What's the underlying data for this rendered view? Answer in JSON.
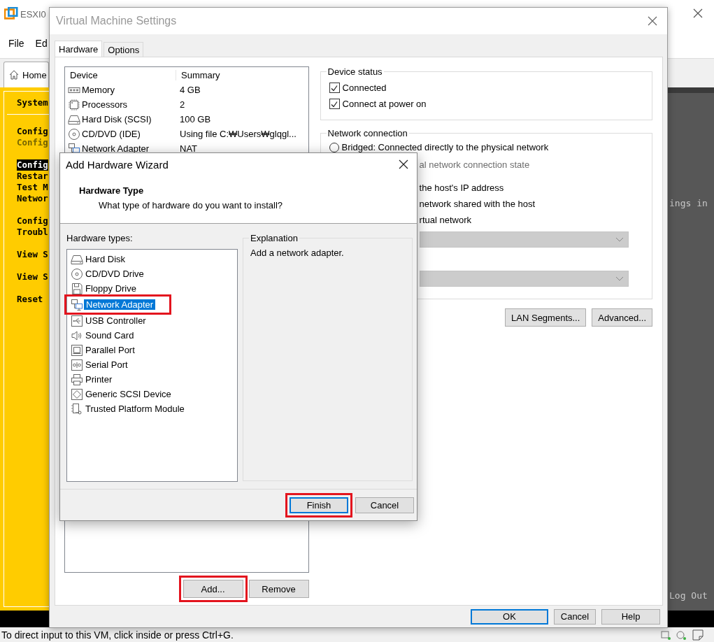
{
  "app": {
    "title": "ESXI0",
    "menu": [
      "File",
      "Ed"
    ],
    "tabs": [
      {
        "label": "Home",
        "selected": true
      }
    ],
    "console": {
      "heading": "System",
      "groups": [
        {
          "items": [
            {
              "text": "Config",
              "selected": false,
              "dimmed": false
            },
            {
              "text": "Config",
              "selected": false,
              "dimmed": true
            }
          ]
        },
        {
          "items": [
            {
              "text": "Config",
              "selected": true,
              "dimmed": false
            },
            {
              "text": "Restar",
              "selected": false,
              "dimmed": false
            },
            {
              "text": "Test M",
              "selected": false,
              "dimmed": false
            },
            {
              "text": "Networ",
              "selected": false,
              "dimmed": false
            }
          ]
        },
        {
          "items": [
            {
              "text": "Config",
              "selected": false,
              "dimmed": false
            },
            {
              "text": "Troubl",
              "selected": false,
              "dimmed": false
            }
          ]
        },
        {
          "items": [
            {
              "text": "View S",
              "selected": false,
              "dimmed": false
            }
          ]
        },
        {
          "items": [
            {
              "text": "View S",
              "selected": false,
              "dimmed": false
            }
          ]
        },
        {
          "items": [
            {
              "text": "Reset",
              "selected": false,
              "dimmed": false
            }
          ]
        }
      ]
    },
    "side_texts": [
      "ings in",
      "Log Out"
    ],
    "status_bar": "To direct input to this VM, click inside or press Ctrl+G."
  },
  "vm_settings": {
    "title": "Virtual Machine Settings",
    "tabs": [
      {
        "label": "Hardware",
        "selected": true
      },
      {
        "label": "Options",
        "selected": false
      }
    ],
    "devices": {
      "columns": [
        "Device",
        "Summary"
      ],
      "rows": [
        {
          "kind": "memory",
          "name": "Memory",
          "summary": "4 GB"
        },
        {
          "kind": "cpu",
          "name": "Processors",
          "summary": "2"
        },
        {
          "kind": "disk",
          "name": "Hard Disk (SCSI)",
          "summary": "100 GB"
        },
        {
          "kind": "cd",
          "name": "CD/DVD (IDE)",
          "summary": "Using file C:₩Users₩glqgl..."
        },
        {
          "kind": "network",
          "name": "Network Adapter",
          "summary": "NAT"
        }
      ]
    },
    "device_buttons": [
      {
        "label": "Add...",
        "highlighted": true
      },
      {
        "label": "Remove",
        "highlighted": false
      }
    ],
    "device_status": {
      "label": "Device status",
      "options": [
        {
          "label": "Connected",
          "checked": true
        },
        {
          "label": "Connect at power on",
          "checked": true
        }
      ]
    },
    "network_connection": {
      "label": "Network connection",
      "rows": [
        {
          "kind": "radio",
          "label": "Bridged: Connected directly to the physical network",
          "selected": false
        },
        {
          "kind": "text",
          "label": "al network connection state",
          "disabled": true
        },
        {
          "kind": "text",
          "label": "the host's IP address",
          "disabled": false
        },
        {
          "kind": "text",
          "label": "network shared with the host",
          "disabled": false
        },
        {
          "kind": "text",
          "label": "rtual network",
          "disabled": false
        },
        {
          "kind": "dropdown",
          "disabled": true
        },
        {
          "kind": "dropdown",
          "disabled": true
        }
      ]
    },
    "network_buttons": [
      "LAN Segments...",
      "Advanced..."
    ],
    "footer_buttons": [
      {
        "label": "OK",
        "default": true
      },
      {
        "label": "Cancel",
        "default": false
      },
      {
        "label": "Help",
        "default": false
      }
    ]
  },
  "wizard": {
    "title": "Add Hardware Wizard",
    "heading": "Hardware Type",
    "subtitle": "What type of hardware do you want to install?",
    "list_label": "Hardware types:",
    "hardware_types": [
      {
        "kind": "disk",
        "label": "Hard Disk",
        "selected": false,
        "highlighted": false
      },
      {
        "kind": "cd",
        "label": "CD/DVD Drive",
        "selected": false,
        "highlighted": false
      },
      {
        "kind": "floppy",
        "label": "Floppy Drive",
        "selected": false,
        "highlighted": false
      },
      {
        "kind": "network",
        "label": "Network Adapter",
        "selected": true,
        "highlighted": true
      },
      {
        "kind": "usb",
        "label": "USB Controller",
        "selected": false,
        "highlighted": false
      },
      {
        "kind": "sound",
        "label": "Sound Card",
        "selected": false,
        "highlighted": false
      },
      {
        "kind": "parallel",
        "label": "Parallel Port",
        "selected": false,
        "highlighted": false
      },
      {
        "kind": "serial",
        "label": "Serial Port",
        "selected": false,
        "highlighted": false
      },
      {
        "kind": "printer",
        "label": "Printer",
        "selected": false,
        "highlighted": false
      },
      {
        "kind": "scsi",
        "label": "Generic SCSI Device",
        "selected": false,
        "highlighted": false
      },
      {
        "kind": "tpm",
        "label": "Trusted Platform Module",
        "selected": false,
        "highlighted": false
      }
    ],
    "explanation": {
      "label": "Explanation",
      "text": "Add a network adapter."
    },
    "buttons": [
      {
        "label": "Finish",
        "default": true,
        "highlighted": true
      },
      {
        "label": "Cancel",
        "default": false,
        "highlighted": false
      }
    ]
  }
}
